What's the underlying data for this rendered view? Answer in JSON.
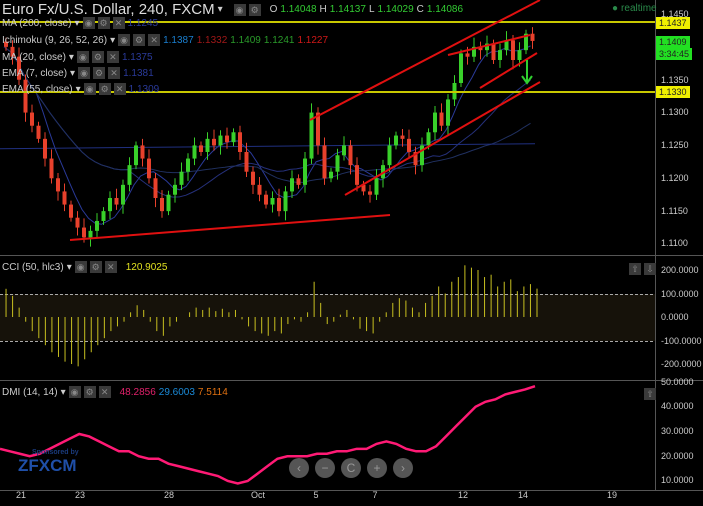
{
  "header": {
    "title": "Euro Fx/U.S. Dollar, 240, FXCM",
    "o_label": "O",
    "o": "1.14048",
    "h_label": "H",
    "h": "1.14137",
    "l_label": "L",
    "l": "1.14029",
    "c_label": "C",
    "c": "1.14086",
    "status": "realtime"
  },
  "indicators": [
    {
      "name": "MA (200, close)",
      "values": [
        "1.1245"
      ]
    },
    {
      "name": "Ichimoku (9, 26, 52, 26)",
      "values": [
        "1.1387",
        "1.1332",
        "1.1409",
        "1.1241",
        "1.1227"
      ]
    },
    {
      "name": "MA (20, close)",
      "values": [
        "1.1375"
      ]
    },
    {
      "name": "EMA (7, close)",
      "values": [
        "1.1381"
      ]
    },
    {
      "name": "EMA (55, close)",
      "values": [
        "1.1309"
      ]
    }
  ],
  "price_axis": [
    "1.1450",
    "1.1350",
    "1.1300",
    "1.1250",
    "1.1200",
    "1.1150",
    "1.1100"
  ],
  "price_tags": {
    "resistance": "1.1437",
    "current": "1.1409",
    "countdown": "3:34:45",
    "support": "1.1330"
  },
  "cci": {
    "name": "CCI (50, hlc3)",
    "value": "120.9025",
    "axis": [
      "200.0000",
      "100.0000",
      "0.0000",
      "-100.0000",
      "-200.0000"
    ],
    "values": [
      120,
      90,
      40,
      -20,
      -60,
      -90,
      -120,
      -150,
      -170,
      -190,
      -200,
      -210,
      -180,
      -150,
      -120,
      -90,
      -60,
      -40,
      -20,
      20,
      50,
      30,
      -20,
      -60,
      -80,
      -40,
      -20,
      0,
      20,
      40,
      30,
      40,
      25,
      35,
      20,
      30,
      -10,
      -40,
      -60,
      -70,
      -80,
      -60,
      -70,
      -30,
      -10,
      -20,
      20,
      150,
      60,
      -30,
      -20,
      10,
      30,
      -10,
      -50,
      -60,
      -70,
      -20,
      20,
      60,
      80,
      70,
      40,
      20,
      60,
      90,
      130,
      100,
      150,
      170,
      220,
      210,
      200,
      170,
      180,
      130,
      150,
      160,
      110,
      130,
      140,
      121
    ]
  },
  "dmi": {
    "name": "DMI (14, 14)",
    "v1": "48.2856",
    "v2": "29.6003",
    "v3": "7.5114",
    "axis": [
      "50.0000",
      "40.0000",
      "30.0000",
      "20.0000",
      "10.0000"
    ],
    "values": [
      23,
      22,
      21,
      20,
      21,
      23,
      25,
      27,
      29,
      28,
      26,
      24,
      22,
      22,
      20,
      19,
      19,
      17,
      16,
      15,
      14,
      13,
      12,
      10,
      9,
      10,
      13,
      16,
      19,
      20,
      20,
      20,
      21,
      21,
      22,
      22,
      23,
      23,
      25,
      26,
      25,
      23,
      22,
      22,
      24,
      28,
      32,
      36,
      40,
      42,
      43,
      45,
      46,
      47,
      48.3
    ]
  },
  "dates": [
    "21",
    "23",
    "28",
    "Oct",
    "5",
    "7",
    "12",
    "14",
    "19"
  ],
  "sponsor": {
    "text": "Sponsored by",
    "brand": "FXCM"
  },
  "nav": [
    "‹",
    "−",
    "C",
    "+",
    "›"
  ],
  "chart_data": {
    "type": "candlestick",
    "symbol": "EURUSD",
    "timeframe": "240",
    "closes": [
      1.14,
      1.1385,
      1.135,
      1.13,
      1.128,
      1.126,
      1.123,
      1.12,
      1.118,
      1.116,
      1.114,
      1.1125,
      1.111,
      1.112,
      1.1135,
      1.115,
      1.117,
      1.116,
      1.119,
      1.122,
      1.125,
      1.123,
      1.12,
      1.117,
      1.115,
      1.1175,
      1.119,
      1.121,
      1.123,
      1.125,
      1.124,
      1.126,
      1.125,
      1.1265,
      1.1255,
      1.127,
      1.124,
      1.121,
      1.119,
      1.1175,
      1.116,
      1.117,
      1.115,
      1.118,
      1.12,
      1.119,
      1.123,
      1.13,
      1.125,
      1.12,
      1.121,
      1.1235,
      1.125,
      1.122,
      1.119,
      1.118,
      1.1175,
      1.12,
      1.122,
      1.125,
      1.1265,
      1.126,
      1.124,
      1.122,
      1.125,
      1.127,
      1.13,
      1.128,
      1.132,
      1.1345,
      1.139,
      1.1385,
      1.14,
      1.1395,
      1.1405,
      1.138,
      1.1395,
      1.141,
      1.138,
      1.1395,
      1.142,
      1.1409
    ],
    "ylim": [
      1.1085,
      1.1465
    ],
    "colors": {
      "up": "#39d02a",
      "down": "#e8412c"
    }
  }
}
